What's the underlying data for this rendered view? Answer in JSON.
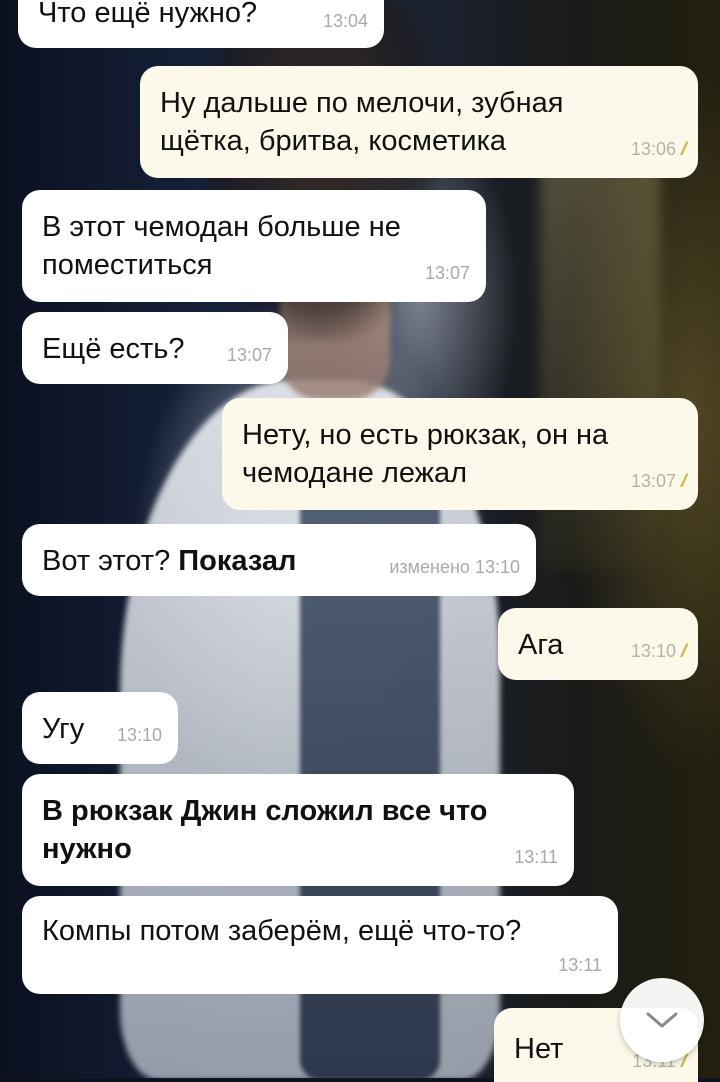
{
  "messages": [
    {
      "id": "m1",
      "direction": "incoming",
      "text": "Что ещё нужно?",
      "time": "13:04"
    },
    {
      "id": "m2",
      "direction": "outgoing",
      "lines": [
        "Ну дальше по мелочи, зубная",
        "щётка, бритва, косметика"
      ],
      "time": "13:06",
      "status": "read"
    },
    {
      "id": "m3",
      "direction": "incoming",
      "lines": [
        "В этот чемодан больше не",
        "поместиться"
      ],
      "time": "13:07"
    },
    {
      "id": "m4",
      "direction": "incoming",
      "text": "Ещё есть?",
      "time": "13:07"
    },
    {
      "id": "m5",
      "direction": "outgoing",
      "lines": [
        "Нету, но есть рюкзак, он на",
        "чемодане лежал"
      ],
      "time": "13:07",
      "status": "read"
    },
    {
      "id": "m6",
      "direction": "incoming",
      "text": "Вот этот?",
      "bold_text": "Показал",
      "edited_label": "изменено",
      "time": "13:10"
    },
    {
      "id": "m7",
      "direction": "outgoing",
      "text": "Ага",
      "time": "13:10",
      "status": "read"
    },
    {
      "id": "m8",
      "direction": "incoming",
      "text": "Угу",
      "time": "13:10"
    },
    {
      "id": "m9",
      "direction": "incoming",
      "lines": [
        "В рюкзак Джин сложил все что",
        "нужно"
      ],
      "bold": true,
      "time": "13:11"
    },
    {
      "id": "m10",
      "direction": "incoming",
      "text": "Компы потом заберём, ещё что-то?",
      "time": "13:11"
    },
    {
      "id": "m11",
      "direction": "outgoing",
      "text": "Нет",
      "time": "13:11",
      "status": "read"
    }
  ],
  "read_check_glyph": "//",
  "colors": {
    "incoming_bubble": "#ffffff",
    "outgoing_bubble": "#fdf9ea",
    "read_check": "#c9b84a",
    "timestamp": "#a9a9a9"
  },
  "icons": {
    "scroll_down": "chevron-down-icon"
  }
}
